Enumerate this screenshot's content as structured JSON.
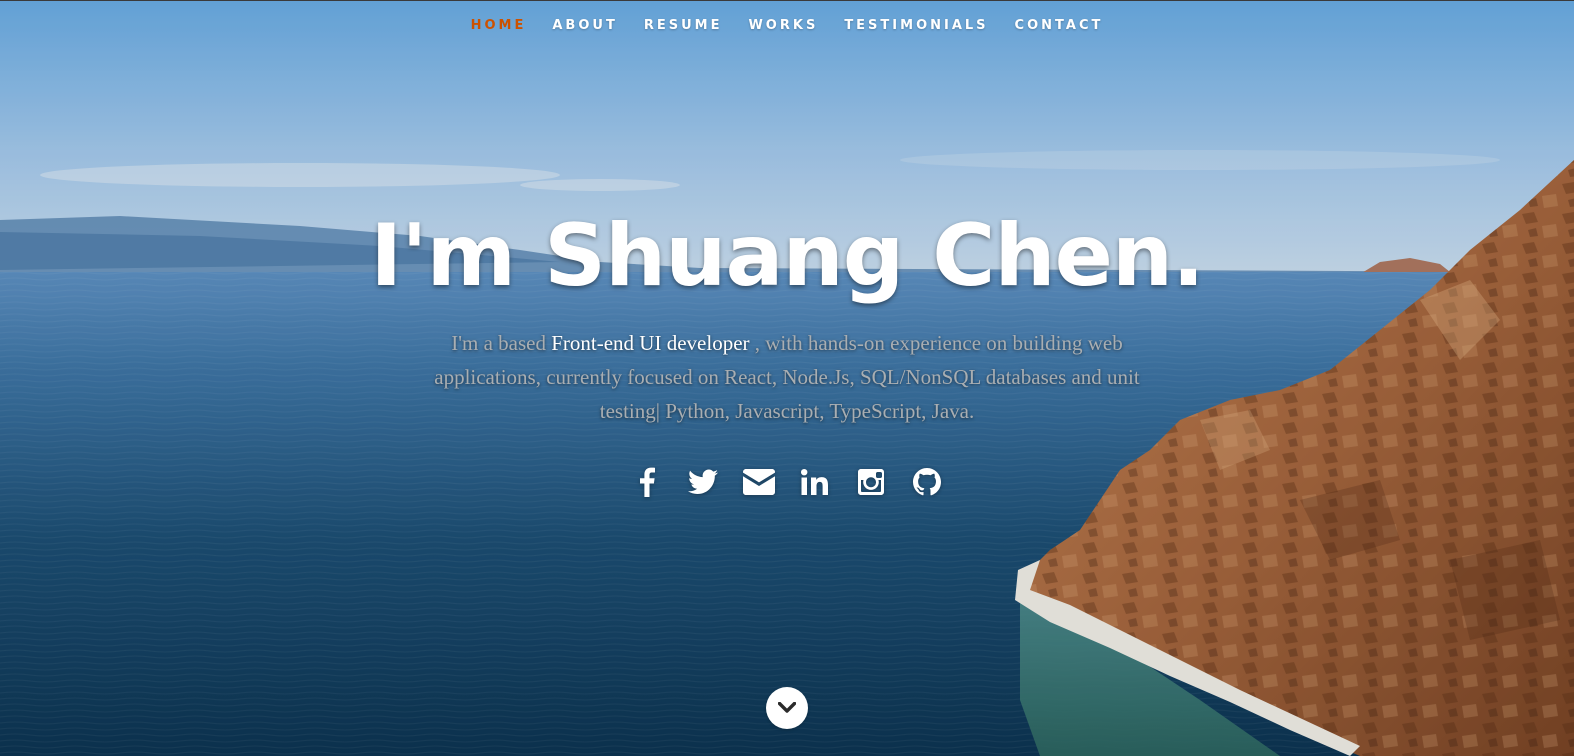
{
  "nav": {
    "items": [
      {
        "label": "HOME",
        "current": true
      },
      {
        "label": "ABOUT",
        "current": false
      },
      {
        "label": "RESUME",
        "current": false
      },
      {
        "label": "WORKS",
        "current": false
      },
      {
        "label": "TESTIMONIALS",
        "current": false
      },
      {
        "label": "CONTACT",
        "current": false
      }
    ],
    "active_color": "#cc5200",
    "text_color": "#ffffff"
  },
  "banner": {
    "headline": "I'm Shuang Chen.",
    "intro_lead": "I'm a based",
    "intro_highlight": "Front-end UI developer",
    "intro_rest": ", with hands-on experience on building web applications, currently focused on React, Node.Js, SQL/NonSQL databases and unit testing| Python, Javascript, TypeScript, Java."
  },
  "social": {
    "icons": [
      "facebook-icon",
      "twitter-icon",
      "email-icon",
      "linkedin-icon",
      "instagram-icon",
      "github-icon"
    ]
  },
  "scroll": {
    "icon": "chevron-down-icon"
  },
  "colors": {
    "sky_top": "#6aaee8",
    "sea_deep": "#0f3b5c",
    "cliff": "#b8744a"
  }
}
